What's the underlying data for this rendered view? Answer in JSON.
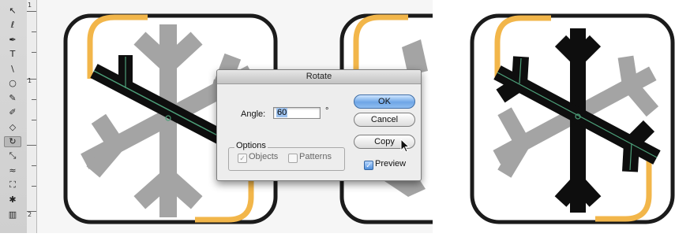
{
  "toolbox": {
    "tools": [
      {
        "name": "direct-selection-tool",
        "glyph": "↖"
      },
      {
        "name": "lasso-tool",
        "glyph": "ℓ"
      },
      {
        "name": "pen-tool",
        "glyph": "✒"
      },
      {
        "name": "type-tool",
        "glyph": "T"
      },
      {
        "name": "line-tool",
        "glyph": "\\"
      },
      {
        "name": "ellipse-tool",
        "glyph": "○"
      },
      {
        "name": "paintbrush-tool",
        "glyph": "✎"
      },
      {
        "name": "pencil-tool",
        "glyph": "✐"
      },
      {
        "name": "eraser-tool",
        "glyph": "◇"
      },
      {
        "name": "rotate-tool",
        "glyph": "↻"
      },
      {
        "name": "scale-tool",
        "glyph": "⤡"
      },
      {
        "name": "warp-tool",
        "glyph": "≈"
      },
      {
        "name": "free-transform-tool",
        "glyph": "⛶"
      },
      {
        "name": "symbol-sprayer-tool",
        "glyph": "✱"
      },
      {
        "name": "graph-tool",
        "glyph": "▥"
      }
    ],
    "active_tool_index": 9
  },
  "ruler": {
    "labels": [
      "1",
      "1",
      "2"
    ]
  },
  "colors": {
    "tile_border": "#1b1b1b",
    "tile_accent": "#f2b64a",
    "ghost_snowflake": "#a4a4a4",
    "snowflake": "#0e0e0e",
    "selection_path": "#4c9e78",
    "primary_button": "#6fa6e6"
  },
  "dialog": {
    "title": "Rotate",
    "angle_label": "Angle:",
    "angle_value": "60",
    "degree_symbol": "°",
    "ok_label": "OK",
    "cancel_label": "Cancel",
    "copy_label": "Copy",
    "options_label": "Options",
    "objects_label": "Objects",
    "objects_checked": true,
    "objects_enabled": false,
    "patterns_label": "Patterns",
    "patterns_checked": false,
    "patterns_enabled": false,
    "preview_label": "Preview",
    "preview_checked": true
  }
}
